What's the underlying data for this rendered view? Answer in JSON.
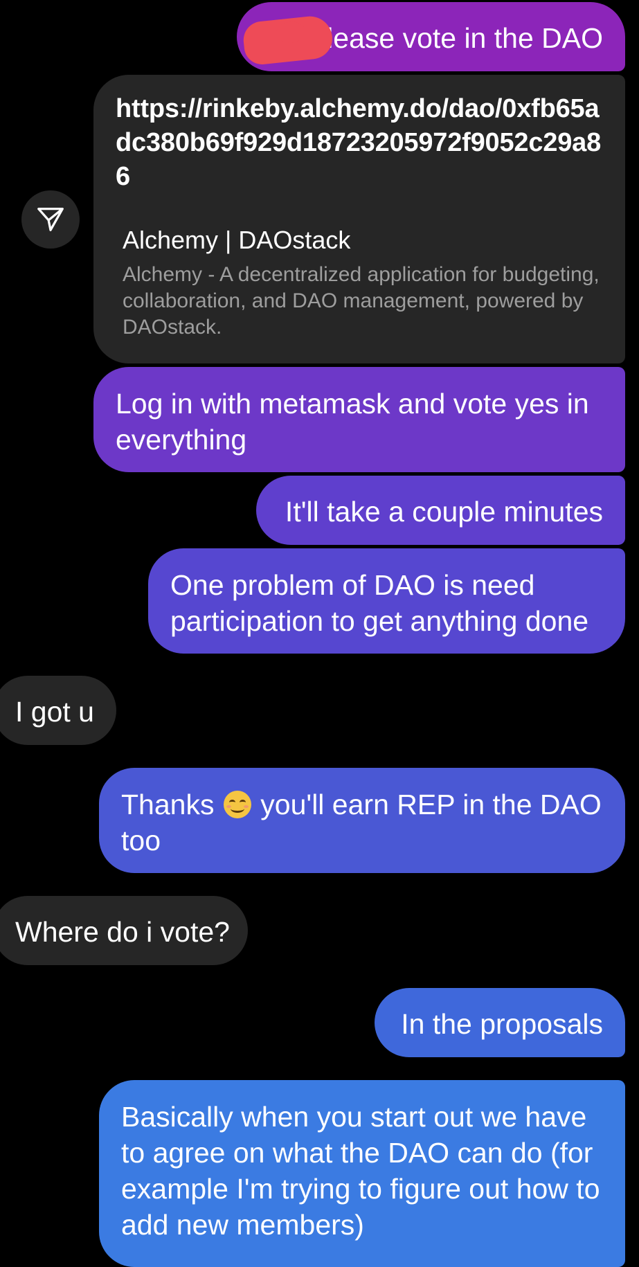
{
  "messages": [
    {
      "id": "m1",
      "side": "sent",
      "text": "lease vote in the DAO",
      "redacted_prefix": true
    },
    {
      "id": "m2",
      "side": "sent",
      "type": "link_preview",
      "url": "https://rinkeby.alchemy.do/dao/0xfb65adc380b69f929d18723205972f9052c29a86",
      "title": "Alchemy | DAOstack",
      "description": "Alchemy - A decentralized application for budgeting, collaboration, and DAO management, powered by DAOstack."
    },
    {
      "id": "m3",
      "side": "sent",
      "text": "Log in with metamask and vote yes in everything"
    },
    {
      "id": "m4",
      "side": "sent",
      "text": "It'll take a couple minutes"
    },
    {
      "id": "m5",
      "side": "sent",
      "text": "One problem of DAO is need participation to get anything done"
    },
    {
      "id": "m6",
      "side": "received",
      "text": "I got u"
    },
    {
      "id": "m7",
      "side": "sent",
      "text_before": "Thanks",
      "emoji": "smiling-face-emoji",
      "text_after": "you'll earn REP in the DAO too"
    },
    {
      "id": "m8",
      "side": "received",
      "text": "Where do i vote?"
    },
    {
      "id": "m9",
      "side": "sent",
      "text": "In the proposals"
    },
    {
      "id": "m10",
      "side": "sent",
      "text": "Basically when you start out we have to agree on what the DAO can do (for example I'm trying to figure out how to add new members)"
    }
  ],
  "share_button": {
    "icon": "send-icon"
  },
  "colors": {
    "background": "#000000",
    "received_bubble": "#262626",
    "sent_gradient": [
      "#8c25b9",
      "#6d38c8",
      "#5f3fcd",
      "#5647d0",
      "#4a58d4",
      "#3f68db",
      "#3b7be2"
    ],
    "redaction": "#ee4b57",
    "preview_description": "#9e9e9e"
  }
}
